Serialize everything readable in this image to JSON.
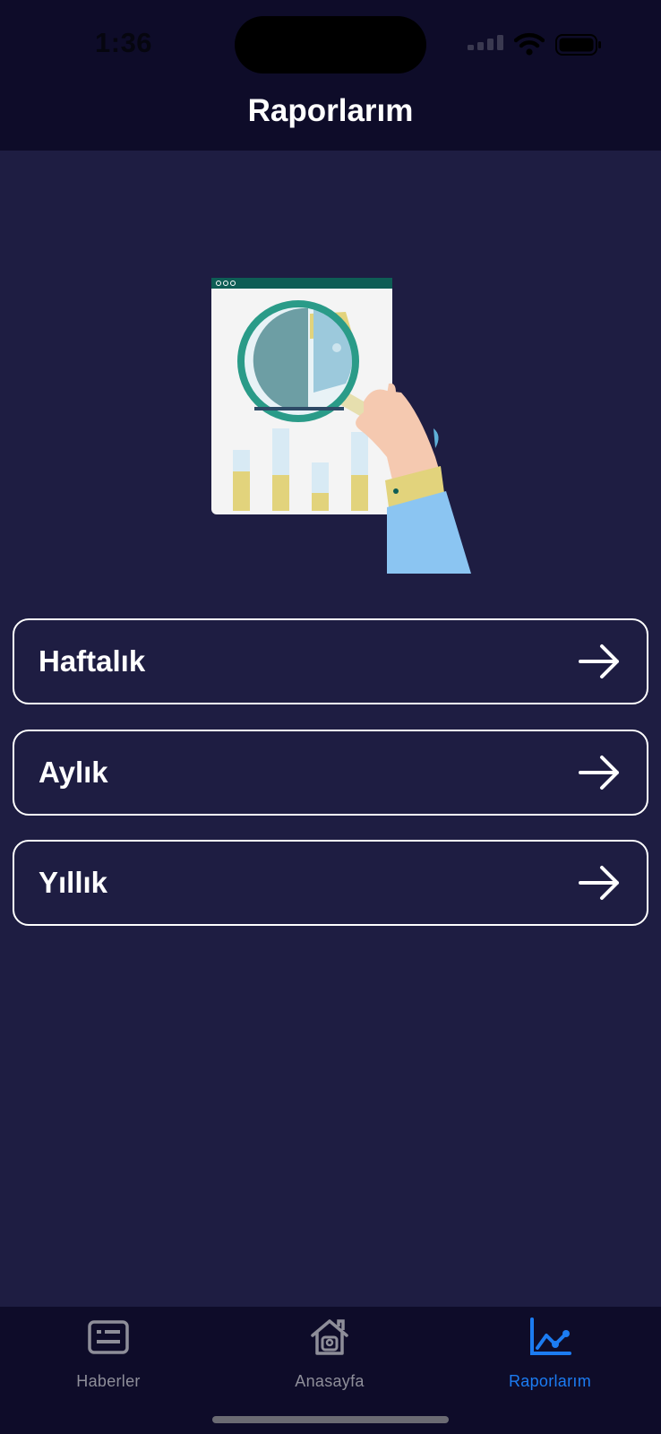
{
  "status_bar": {
    "time": "1:36",
    "icons": [
      "signal-icon",
      "wifi-icon",
      "battery-icon"
    ]
  },
  "header": {
    "title": "Raporlarım"
  },
  "hero": {
    "illustration": "report-magnifier-illustration"
  },
  "menu": {
    "items": [
      {
        "label": "Haftalık",
        "icon": "arrow-right-icon"
      },
      {
        "label": "Aylık",
        "icon": "arrow-right-icon"
      },
      {
        "label": "Yıllık",
        "icon": "arrow-right-icon"
      }
    ]
  },
  "tab_bar": {
    "tabs": [
      {
        "label": "Haberler",
        "icon": "news-icon",
        "active": false
      },
      {
        "label": "Anasayfa",
        "icon": "home-icon",
        "active": false
      },
      {
        "label": "Raporlarım",
        "icon": "chart-icon",
        "active": true
      }
    ]
  },
  "colors": {
    "background": "#1e1d42",
    "bars": "#0e0c29",
    "accent": "#1c7cf2",
    "inactive": "#8e8e99"
  }
}
